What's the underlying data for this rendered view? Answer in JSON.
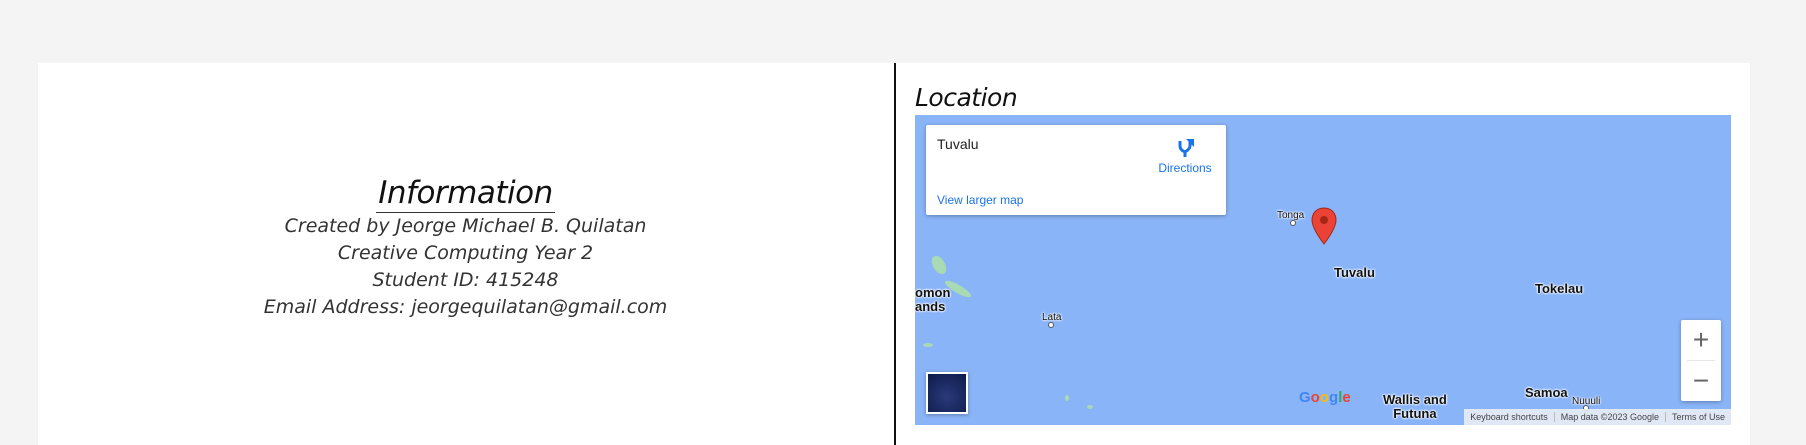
{
  "info": {
    "title": "Information",
    "lines": [
      "Created by Jeorge Michael B. Quilatan",
      "Creative Computing Year 2",
      "Student ID: 415248",
      "Email Address: jeorgequilatan@gmail.com"
    ]
  },
  "location": {
    "title": "Location",
    "map": {
      "place_name": "Tuvalu",
      "directions_label": "Directions",
      "view_larger": "View larger map",
      "labels": {
        "tonga": "Tonga",
        "tuvalu": "Tuvalu",
        "tokelau": "Tokelau",
        "solomon": "omon\nands",
        "lata": "Lata",
        "wallis": "Wallis and\nFutuna",
        "samoa": "Samoa",
        "nuuuli": "Nuuuli"
      },
      "google_logo": "Google",
      "footer": {
        "shortcuts": "Keyboard shortcuts",
        "map_data": "Map data ©2023 Google",
        "terms": "Terms of Use"
      },
      "zoom_in": "+",
      "zoom_out": "−"
    }
  },
  "colors": {
    "background": "#f4f4f4",
    "card": "#ffffff",
    "ocean": "#8ab4f8",
    "link": "#1a73e8",
    "pin": "#ea4335"
  }
}
